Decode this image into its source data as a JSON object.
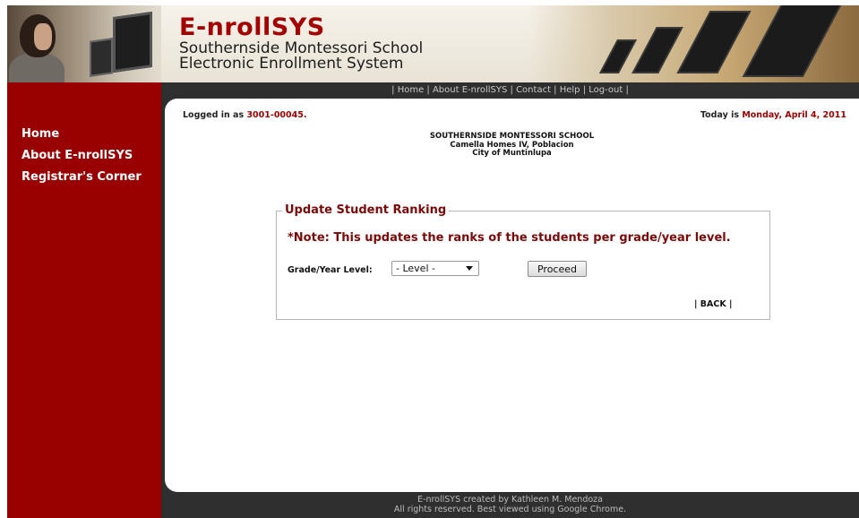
{
  "header": {
    "app_title": "E-nrollSYS",
    "subtitle_line1": "Southernside Montessori School",
    "subtitle_line2": "Electronic Enrollment System"
  },
  "topnav": {
    "items": [
      "Home",
      "About E-nrollSYS",
      "Contact",
      "Help",
      "Log-out"
    ]
  },
  "sidebar": {
    "items": [
      {
        "label": "Home"
      },
      {
        "label": "About E-nrollSYS"
      },
      {
        "label": "Registrar's Corner"
      }
    ]
  },
  "status": {
    "logged_prefix": "Logged in as ",
    "user_id": "3001-00045.",
    "today_prefix": "Today is ",
    "date": "Monday, April 4, 2011"
  },
  "school": {
    "name": "SOUTHERNSIDE MONTESSORI SCHOOL",
    "address1": "Camella Homes IV, Poblacion",
    "address2": "City of Muntinlupa"
  },
  "form": {
    "legend": "Update Student Ranking",
    "note": "*Note: This updates the ranks of the students per grade/year level.",
    "grade_label": "Grade/Year Level:",
    "grade_selected": "- Level -",
    "proceed_label": "Proceed",
    "back_label": "| BACK |"
  },
  "footer": {
    "line1": "E-nrollSYS created by Kathleen M. Mendoza",
    "line2": "All rights reserved. Best viewed using Google Chrome."
  },
  "colors": {
    "brand_red": "#990000",
    "frame_dark": "#2f2f2f",
    "heading_red": "#7a0a0a"
  }
}
